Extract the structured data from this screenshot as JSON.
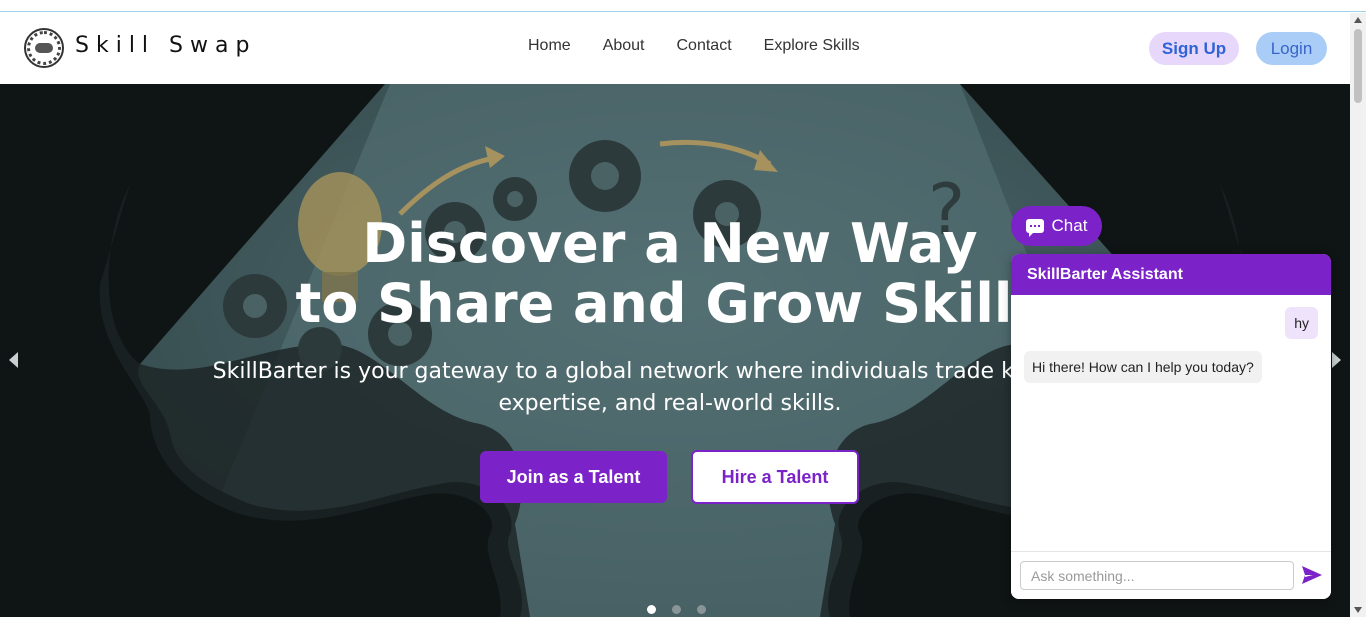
{
  "brand": {
    "name": "Skill Swap"
  },
  "nav": {
    "links": [
      "Home",
      "About",
      "Contact",
      "Explore Skills"
    ],
    "signup_label": "Sign Up",
    "login_label": "Login"
  },
  "hero": {
    "title_line1": "Discover a New Way",
    "title_line2": "to Share and Grow Skills",
    "subtitle_line1": "SkillBarter is your gateway to a global network where individuals trade knowledge,",
    "subtitle_line2": "expertise, and real-world skills.",
    "join_label": "Join as a Talent",
    "hire_label": "Hire a Talent",
    "slide_count": 3,
    "active_slide": 1
  },
  "chat": {
    "toggle_label": "Chat",
    "header": "SkillBarter Assistant",
    "messages": [
      {
        "from": "user",
        "text": "hy"
      },
      {
        "from": "bot",
        "text": "Hi there! How can I help you today?"
      }
    ],
    "input_placeholder": "Ask something..."
  },
  "colors": {
    "accent": "#7b22c9",
    "signup_bg": "#e7d8fb",
    "login_bg": "#a9cdf7"
  }
}
